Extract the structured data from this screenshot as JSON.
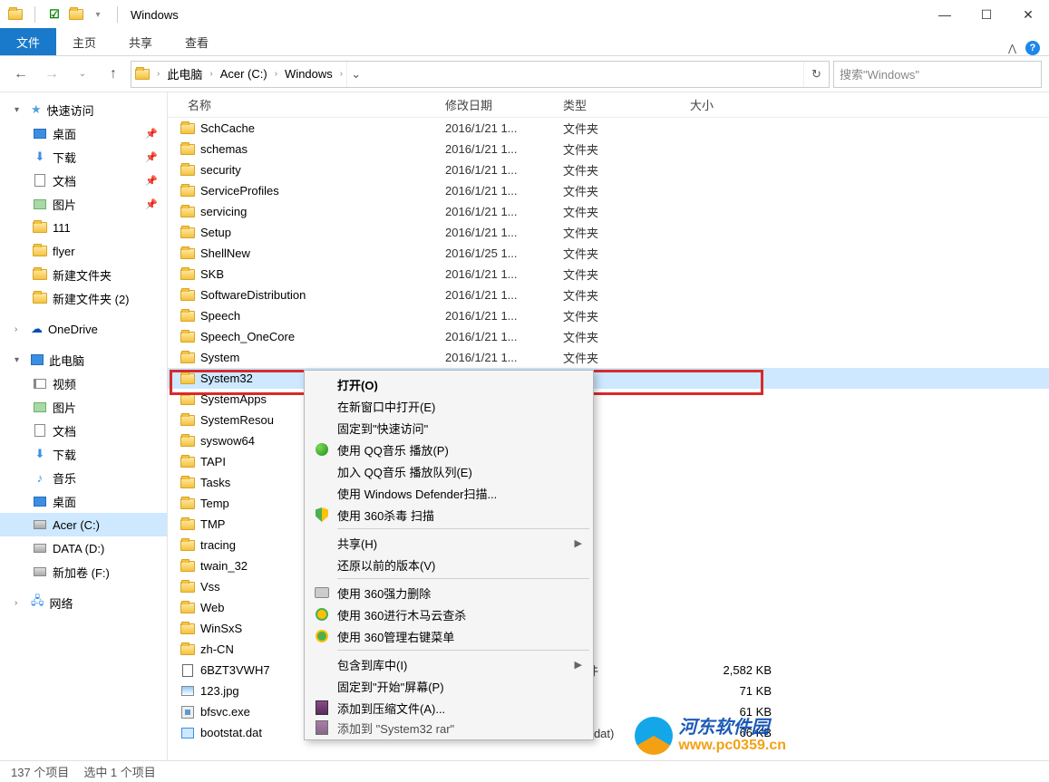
{
  "window": {
    "title": "Windows"
  },
  "ribbon": {
    "file": "文件",
    "tabs": [
      "主页",
      "共享",
      "查看"
    ]
  },
  "breadcrumb": [
    "此电脑",
    "Acer (C:)",
    "Windows"
  ],
  "search_placeholder": "搜索\"Windows\"",
  "columns": {
    "name": "名称",
    "date": "修改日期",
    "type": "类型",
    "size": "大小"
  },
  "sidebar": {
    "quick": {
      "label": "快速访问",
      "items": [
        {
          "label": "桌面",
          "icon": "desktop",
          "pinned": true
        },
        {
          "label": "下载",
          "icon": "download",
          "pinned": true
        },
        {
          "label": "文档",
          "icon": "doc",
          "pinned": true
        },
        {
          "label": "图片",
          "icon": "pic",
          "pinned": true
        },
        {
          "label": "111",
          "icon": "folder"
        },
        {
          "label": "flyer",
          "icon": "folder"
        },
        {
          "label": "新建文件夹",
          "icon": "folder"
        },
        {
          "label": "新建文件夹 (2)",
          "icon": "folder"
        }
      ]
    },
    "onedrive": "OneDrive",
    "thispc": {
      "label": "此电脑",
      "items": [
        {
          "label": "视频",
          "icon": "video"
        },
        {
          "label": "图片",
          "icon": "pic"
        },
        {
          "label": "文档",
          "icon": "doc"
        },
        {
          "label": "下载",
          "icon": "download"
        },
        {
          "label": "音乐",
          "icon": "music"
        },
        {
          "label": "桌面",
          "icon": "desktop"
        },
        {
          "label": "Acer (C:)",
          "icon": "drive",
          "selected": true
        },
        {
          "label": "DATA (D:)",
          "icon": "drive"
        },
        {
          "label": "新加卷 (F:)",
          "icon": "drive"
        }
      ]
    },
    "network": "网络"
  },
  "files": [
    {
      "name": "SchCache",
      "date": "2016/1/21 1...",
      "type": "文件夹",
      "icon": "folder"
    },
    {
      "name": "schemas",
      "date": "2016/1/21 1...",
      "type": "文件夹",
      "icon": "folder"
    },
    {
      "name": "security",
      "date": "2016/1/21 1...",
      "type": "文件夹",
      "icon": "folder"
    },
    {
      "name": "ServiceProfiles",
      "date": "2016/1/21 1...",
      "type": "文件夹",
      "icon": "folder"
    },
    {
      "name": "servicing",
      "date": "2016/1/21 1...",
      "type": "文件夹",
      "icon": "folder"
    },
    {
      "name": "Setup",
      "date": "2016/1/21 1...",
      "type": "文件夹",
      "icon": "folder"
    },
    {
      "name": "ShellNew",
      "date": "2016/1/25 1...",
      "type": "文件夹",
      "icon": "folder"
    },
    {
      "name": "SKB",
      "date": "2016/1/21 1...",
      "type": "文件夹",
      "icon": "folder"
    },
    {
      "name": "SoftwareDistribution",
      "date": "2016/1/21 1...",
      "type": "文件夹",
      "icon": "folder"
    },
    {
      "name": "Speech",
      "date": "2016/1/21 1...",
      "type": "文件夹",
      "icon": "folder"
    },
    {
      "name": "Speech_OneCore",
      "date": "2016/1/21 1...",
      "type": "文件夹",
      "icon": "folder"
    },
    {
      "name": "System",
      "date": "2016/1/21 1...",
      "type": "文件夹",
      "icon": "folder"
    },
    {
      "name": "System32",
      "date": "",
      "type": "夹",
      "icon": "folder",
      "selected": true
    },
    {
      "name": "SystemApps",
      "date": "",
      "type": "夹",
      "icon": "folder"
    },
    {
      "name": "SystemResou",
      "date": "",
      "type": "夹",
      "icon": "folder"
    },
    {
      "name": "syswow64",
      "date": "",
      "type": "夹",
      "icon": "folder"
    },
    {
      "name": "TAPI",
      "date": "",
      "type": "夹",
      "icon": "folder"
    },
    {
      "name": "Tasks",
      "date": "",
      "type": "夹",
      "icon": "folder"
    },
    {
      "name": "Temp",
      "date": "",
      "type": "夹",
      "icon": "folder"
    },
    {
      "name": "TMP",
      "date": "",
      "type": "夹",
      "icon": "folder"
    },
    {
      "name": "tracing",
      "date": "",
      "type": "夹",
      "icon": "folder"
    },
    {
      "name": "twain_32",
      "date": "",
      "type": "夹",
      "icon": "folder"
    },
    {
      "name": "Vss",
      "date": "",
      "type": "夹",
      "icon": "folder"
    },
    {
      "name": "Web",
      "date": "",
      "type": "夹",
      "icon": "folder"
    },
    {
      "name": "WinSxS",
      "date": "",
      "type": "夹",
      "icon": "folder"
    },
    {
      "name": "zh-CN",
      "date": "",
      "type": "夹",
      "icon": "folder"
    },
    {
      "name": "6BZT3VWH7",
      "date": "",
      "type": "N 文件",
      "size": "2,582 KB",
      "icon": "bin"
    },
    {
      "name": "123.jpg",
      "date": "",
      "type": "文件",
      "size": "71 KB",
      "icon": "jpg"
    },
    {
      "name": "bfsvc.exe",
      "date": "",
      "type": "序",
      "size": "61 KB",
      "icon": "exe"
    },
    {
      "name": "bootstat.dat",
      "date": "",
      "type": "文件(.dat)",
      "size": "66 KB",
      "icon": "dat"
    }
  ],
  "context_menu": [
    {
      "label": "打开(O)",
      "bold": true
    },
    {
      "label": "在新窗口中打开(E)"
    },
    {
      "label": "固定到\"快速访问\""
    },
    {
      "label": "使用 QQ音乐 播放(P)",
      "icon": "qq"
    },
    {
      "label": "加入 QQ音乐 播放队列(E)"
    },
    {
      "label": "使用 Windows Defender扫描..."
    },
    {
      "label": "使用 360杀毒 扫描",
      "icon": "shield"
    },
    {
      "sep": true
    },
    {
      "label": "共享(H)",
      "arrow": true
    },
    {
      "label": "还原以前的版本(V)"
    },
    {
      "sep": true
    },
    {
      "label": "使用 360强力删除",
      "icon": "printer"
    },
    {
      "label": "使用 360进行木马云查杀",
      "icon": "360y"
    },
    {
      "label": "使用 360管理右键菜单",
      "icon": "360g"
    },
    {
      "sep": true
    },
    {
      "label": "包含到库中(I)",
      "arrow": true
    },
    {
      "label": "固定到\"开始\"屏幕(P)"
    },
    {
      "label": "添加到压缩文件(A)...",
      "icon": "rar"
    },
    {
      "label": "添加到 \"System32 rar\"",
      "icon": "rar",
      "cut": true
    }
  ],
  "status": {
    "count": "137 个项目",
    "selected": "选中 1 个项目"
  },
  "watermark": {
    "cn": "河东软件园",
    "url": "www.pc0359.cn"
  }
}
